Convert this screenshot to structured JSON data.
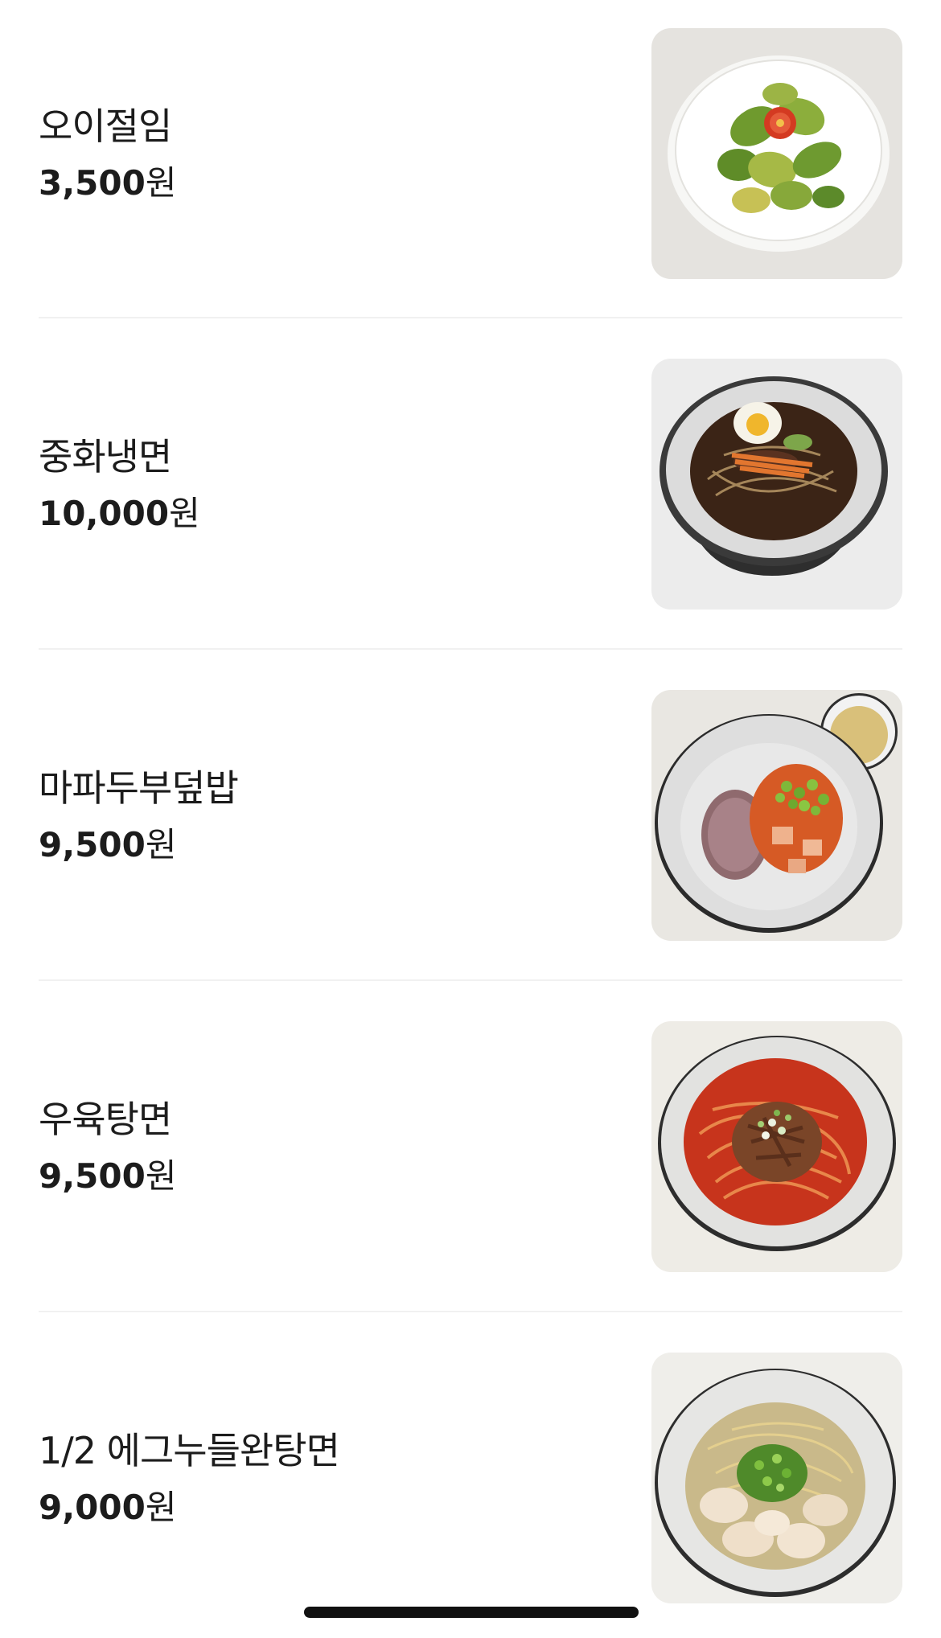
{
  "menu": {
    "currency_unit": "원",
    "items": [
      {
        "name": "오이절임",
        "price": "3,500",
        "image": "cucumber-pickle-photo"
      },
      {
        "name": "중화냉면",
        "price": "10,000",
        "image": "chinese-cold-noodle-photo"
      },
      {
        "name": "마파두부덮밥",
        "price": "9,500",
        "image": "mapo-tofu-rice-photo"
      },
      {
        "name": "우육탕면",
        "price": "9,500",
        "image": "beef-noodle-soup-photo"
      },
      {
        "name": "1/2 에그누들완탕면",
        "price": "9,000",
        "image": "wonton-egg-noodle-photo"
      }
    ]
  },
  "colors": {
    "text": "#1c1c1c",
    "divider": "#f1f1f1",
    "home_indicator": "#111111"
  }
}
